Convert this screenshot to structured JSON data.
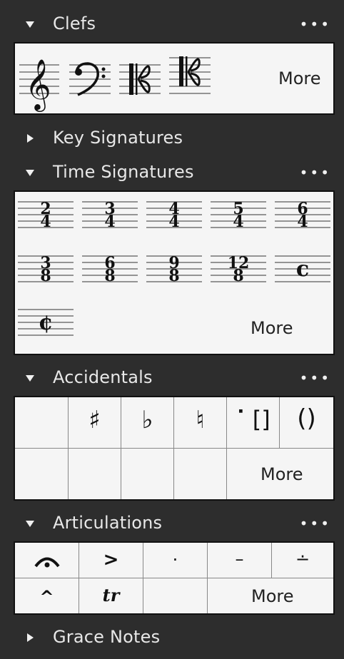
{
  "sections": {
    "clefs": {
      "title": "Clefs",
      "more_label": "More",
      "items": [
        "treble-clef-icon",
        "bass-clef-icon",
        "alto-clef-icon",
        "tenor-clef-icon"
      ]
    },
    "key_signatures": {
      "title": "Key Signatures"
    },
    "time_signatures": {
      "title": "Time Signatures",
      "more_label": "More",
      "items": [
        {
          "top": "2",
          "bottom": "4"
        },
        {
          "top": "3",
          "bottom": "4"
        },
        {
          "top": "4",
          "bottom": "4"
        },
        {
          "top": "5",
          "bottom": "4"
        },
        {
          "top": "6",
          "bottom": "4"
        },
        {
          "top": "3",
          "bottom": "8"
        },
        {
          "top": "6",
          "bottom": "8"
        },
        {
          "top": "9",
          "bottom": "8"
        },
        {
          "top": "12",
          "bottom": "8"
        },
        {
          "symbol": "𝄴"
        },
        {
          "symbol": "𝄵"
        }
      ]
    },
    "accidentals": {
      "title": "Accidentals",
      "more_label": "More",
      "symbols": [
        "",
        "♯",
        "♭",
        "♮",
        "⠁[]",
        "()"
      ]
    },
    "articulations": {
      "title": "Articulations",
      "more_label": "More",
      "row1": [
        "𝄐",
        ">",
        "·",
        "–",
        "∸"
      ],
      "row2": [
        "^",
        "tr",
        ""
      ]
    },
    "grace_notes": {
      "title": "Grace Notes"
    }
  },
  "menu_glyph": "•••"
}
